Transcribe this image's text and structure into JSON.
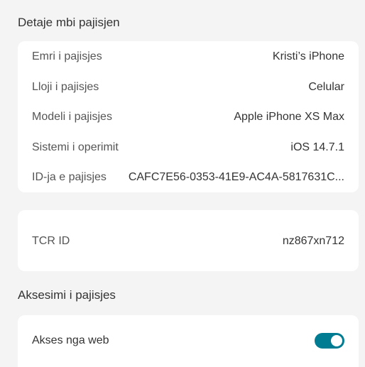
{
  "device_details": {
    "title": "Detaje mbi pajisjen",
    "rows": [
      {
        "label": "Emri i pajisjes",
        "value": "Kristi’s iPhone"
      },
      {
        "label": "Lloji i pajisjes",
        "value": "Celular"
      },
      {
        "label": "Modeli i pajisjes",
        "value": "Apple iPhone XS Max"
      },
      {
        "label": "Sistemi i operimit",
        "value": "iOS 14.7.1"
      },
      {
        "label": "ID-ja e pajisjes",
        "value": "CAFC7E56-0353-41E9-AC4A-5817631C..."
      }
    ]
  },
  "tcr": {
    "label": "TCR ID",
    "value": "nz867xn712"
  },
  "device_access": {
    "title": "Aksesimi i pajisjes",
    "web_access": {
      "label": "Akses nga web",
      "enabled": true,
      "toggle_color": "#007c92"
    }
  }
}
